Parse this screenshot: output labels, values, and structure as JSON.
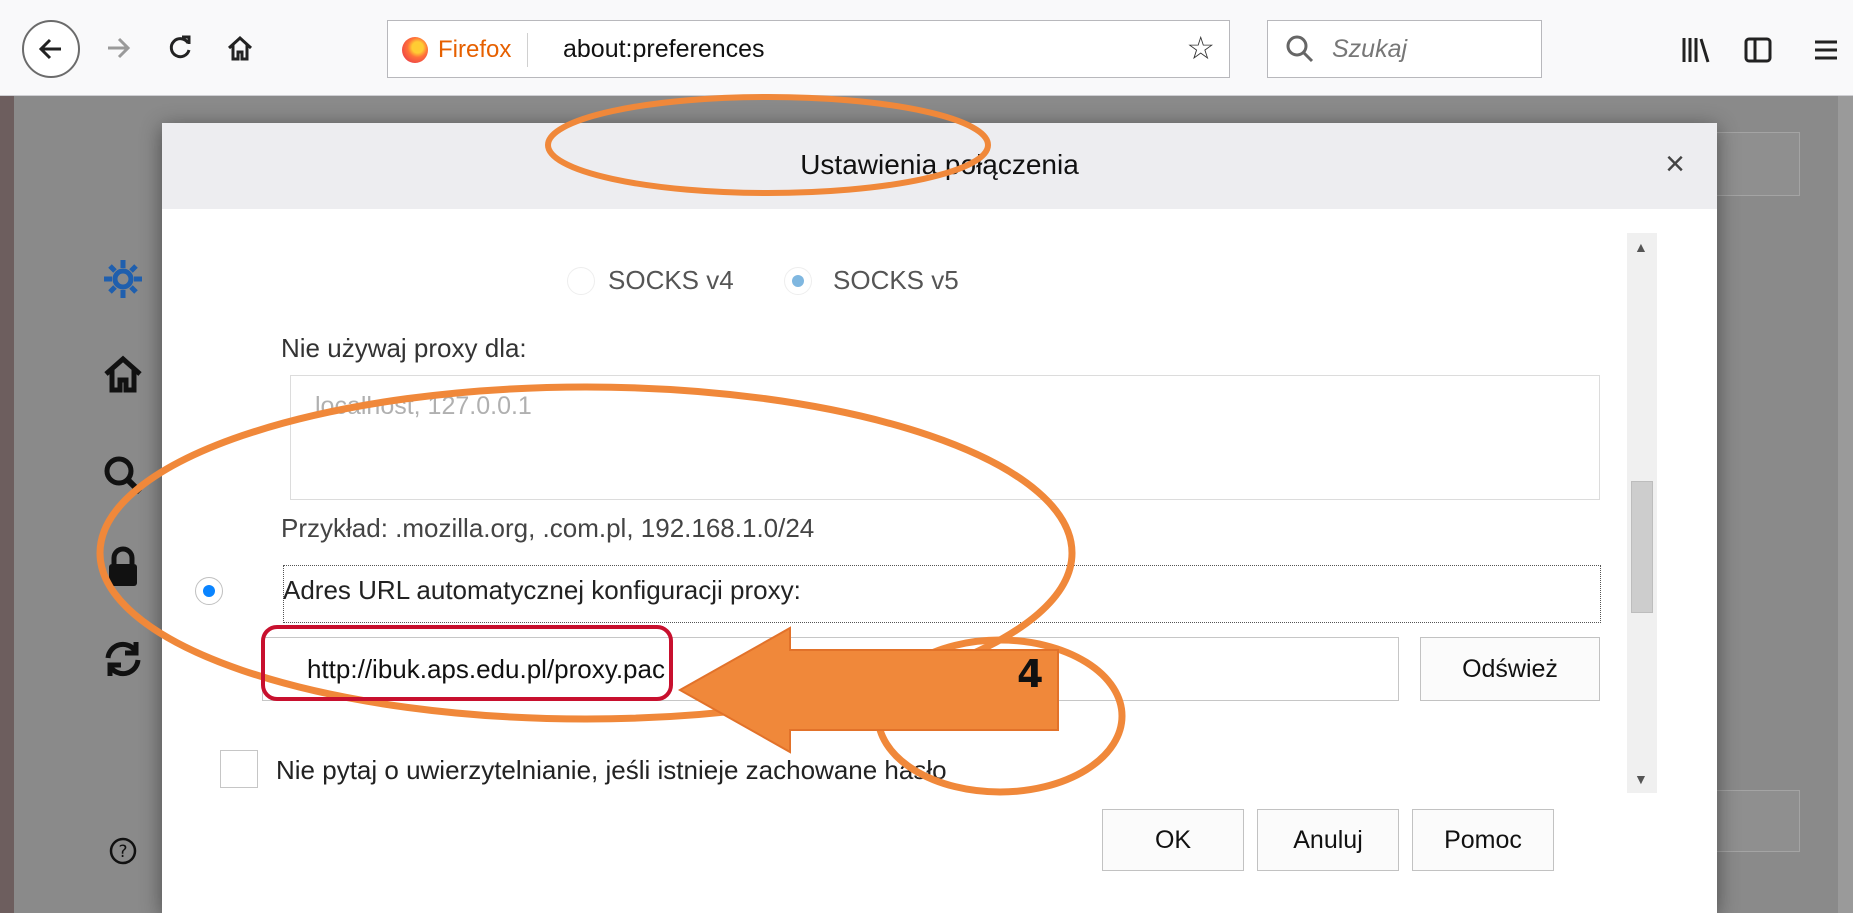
{
  "browser": {
    "identity_label": "Firefox",
    "url": "about:preferences",
    "search_placeholder": "Szukaj"
  },
  "dialog": {
    "title": "Ustawienia połączenia",
    "close_label": "×",
    "socks": {
      "v4_label": "SOCKS v4",
      "v5_label": "SOCKS v5",
      "selected": "SOCKS v5"
    },
    "no_proxy_label": "Nie używaj proxy dla:",
    "no_proxy_value": "localhost, 127.0.0.1",
    "example_text": "Przykład: .mozilla.org, .com.pl, 192.168.1.0/24",
    "auto_config_label": "Adres URL automatycznej konfiguracji proxy:",
    "auto_config_selected": true,
    "pac_url": "http://ibuk.aps.edu.pl/proxy.pac",
    "refresh_button": "Odśwież",
    "no_auth_prompt_label": "Nie pytaj o uwierzytelnianie, jeśli istnieje zachowane hasło",
    "no_auth_prompt_checked": false,
    "buttons": {
      "ok": "OK",
      "cancel": "Anuluj",
      "help": "Pomoc"
    }
  },
  "annotations": {
    "step_number": "4",
    "highlight_color": "#f0883a",
    "url_box_color": "#c8102e"
  },
  "colors": {
    "accent": "#0a84ff",
    "toolbar_bg": "#f9f9fa",
    "dialog_header_bg": "#ededf0"
  }
}
